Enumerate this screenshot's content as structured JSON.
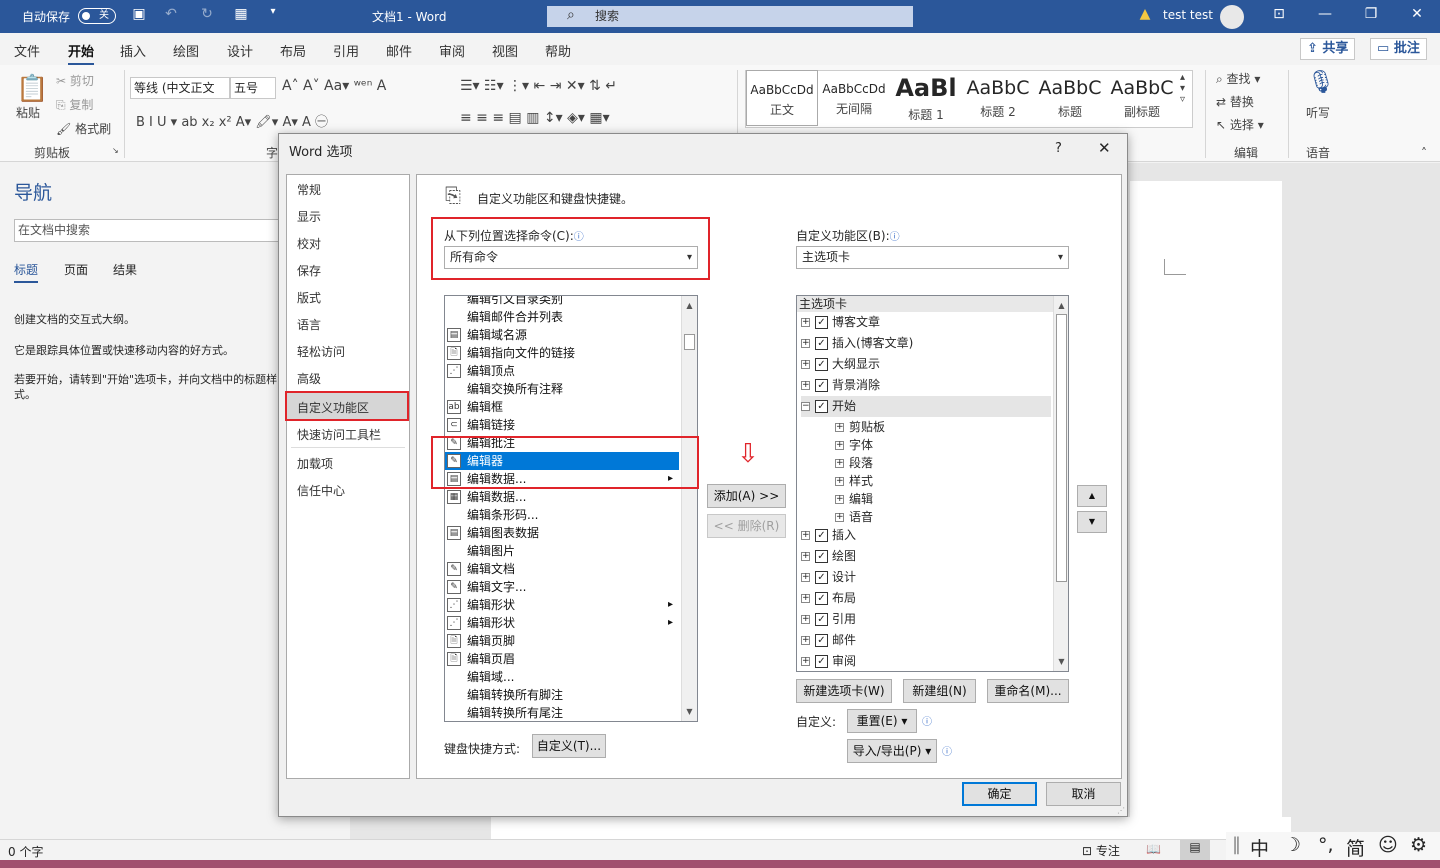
{
  "titlebar": {
    "autosave_label": "自动保存",
    "autosave_state": "关",
    "doc_title": "文档1 - Word",
    "search_placeholder": "搜索",
    "user": "test test"
  },
  "ribbon_tabs": [
    "文件",
    "开始",
    "插入",
    "绘图",
    "设计",
    "布局",
    "引用",
    "邮件",
    "审阅",
    "视图",
    "帮助"
  ],
  "ribbon_actions": {
    "share": "共享",
    "comments": "批注"
  },
  "clipboard": {
    "paste": "粘贴",
    "cut": "剪切",
    "copy": "复制",
    "format_painter": "格式刷",
    "group": "剪贴板"
  },
  "font": {
    "name": "等线 (中文正文",
    "size": "五号",
    "group_partial": "字"
  },
  "styles": [
    {
      "sample": "AaBbCcDd",
      "name": "正文"
    },
    {
      "sample": "AaBbCcDd",
      "name": "无间隔"
    },
    {
      "sample": "AaBl",
      "name": "标题 1"
    },
    {
      "sample": "AaBbC",
      "name": "标题 2"
    },
    {
      "sample": "AaBbC",
      "name": "标题"
    },
    {
      "sample": "AaBbC",
      "name": "副标题"
    }
  ],
  "editing": {
    "find": "查找",
    "replace": "替换",
    "select": "选择",
    "group": "编辑"
  },
  "voice": {
    "dictate": "听写",
    "group": "语音"
  },
  "nav": {
    "title": "导航",
    "search_placeholder": "在文档中搜索",
    "tabs": [
      "标题",
      "页面",
      "结果"
    ],
    "p1": "创建文档的交互式大纲。",
    "p2": "它是跟踪具体位置或快速移动内容的好方式。",
    "p3": "若要开始，请转到\"开始\"选项卡，并向文档中的标题样式。"
  },
  "dialog": {
    "title": "Word 选项",
    "help": "?",
    "close": "✕",
    "categories": [
      "常规",
      "显示",
      "校对",
      "保存",
      "版式",
      "语言",
      "轻松访问",
      "高级",
      "自定义功能区",
      "快速访问工具栏",
      "加载项",
      "信任中心"
    ],
    "header": "自定义功能区和键盘快捷键。",
    "choose_label": "从下列位置选择命令(C):",
    "choose_value": "所有命令",
    "customize_label": "自定义功能区(B):",
    "customize_value": "主选项卡",
    "commands": [
      "编辑引文目录类别",
      "编辑邮件合并列表",
      "编辑域名源",
      "编辑指向文件的链接",
      "编辑顶点",
      "编辑交换所有注释",
      "编辑框",
      "编辑链接",
      "编辑批注",
      "编辑器",
      "编辑数据...",
      "编辑数据...",
      "编辑条形码...",
      "编辑图表数据",
      "编辑图片",
      "编辑文档",
      "编辑文字...",
      "编辑形状",
      "编辑形状",
      "编辑页脚",
      "编辑页眉",
      "编辑域...",
      "编辑转换所有脚注",
      "编辑转换所有尾注"
    ],
    "selected_command": "编辑器",
    "add_btn": "添加(A) >>",
    "remove_btn": "<< 删除(R)",
    "tree_header": "主选项卡",
    "tree": [
      {
        "label": "博客文章",
        "level": 0,
        "expand": "+"
      },
      {
        "label": "插入(博客文章)",
        "level": 0,
        "expand": "+"
      },
      {
        "label": "大纲显示",
        "level": 0,
        "expand": "+"
      },
      {
        "label": "背景消除",
        "level": 0,
        "expand": "+"
      },
      {
        "label": "开始",
        "level": 0,
        "expand": "−"
      },
      {
        "label": "剪贴板",
        "level": 1,
        "expand": "+"
      },
      {
        "label": "字体",
        "level": 1,
        "expand": "+"
      },
      {
        "label": "段落",
        "level": 1,
        "expand": "+"
      },
      {
        "label": "样式",
        "level": 1,
        "expand": "+"
      },
      {
        "label": "编辑",
        "level": 1,
        "expand": "+"
      },
      {
        "label": "语音",
        "level": 1,
        "expand": "+"
      },
      {
        "label": "插入",
        "level": 0,
        "expand": "+"
      },
      {
        "label": "绘图",
        "level": 0,
        "expand": "+"
      },
      {
        "label": "设计",
        "level": 0,
        "expand": "+"
      },
      {
        "label": "布局",
        "level": 0,
        "expand": "+"
      },
      {
        "label": "引用",
        "level": 0,
        "expand": "+"
      },
      {
        "label": "邮件",
        "level": 0,
        "expand": "+"
      },
      {
        "label": "审阅",
        "level": 0,
        "expand": "+"
      }
    ],
    "new_tab": "新建选项卡(W)",
    "new_group": "新建组(N)",
    "rename": "重命名(M)...",
    "customizations_label": "自定义:",
    "reset": "重置(E) ▾",
    "import_export": "导入/导出(P) ▾",
    "keyboard_label": "键盘快捷方式:",
    "keyboard_btn": "自定义(T)...",
    "ok": "确定",
    "cancel": "取消"
  },
  "status": {
    "words": "0 个字",
    "focus": "专注",
    "ime_chars": [
      "中",
      "☽",
      "°,",
      "简",
      "☺",
      "⚙"
    ]
  }
}
